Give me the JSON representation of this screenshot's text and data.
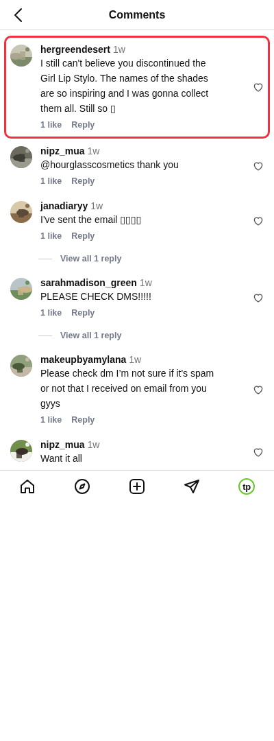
{
  "header": {
    "title": "Comments"
  },
  "comments": [
    {
      "username": "hergreendesert",
      "time": "1w",
      "text": "I still can't believe you discontinued the Girl Lip Stylo. The names of the shades are so inspiring and I was gonna collect them all. Still so ▯",
      "likes": "1 like",
      "reply": "Reply",
      "highlighted": true,
      "liked": false
    },
    {
      "username": "nipz_mua",
      "time": "1w",
      "text": "@hourglasscosmetics thank you",
      "likes": "1 like",
      "reply": "Reply",
      "highlighted": false,
      "liked": false
    },
    {
      "username": "janadiaryy",
      "time": "1w",
      "text": "I've sent the email ▯▯▯▯",
      "likes": "1 like",
      "reply": "Reply",
      "highlighted": false,
      "liked": false,
      "view_replies": "View all 1 reply"
    },
    {
      "username": "sarahmadison_green",
      "time": "1w",
      "text": "PLEASE CHECK DMS!!!!!",
      "likes": "1 like",
      "reply": "Reply",
      "highlighted": false,
      "liked": false,
      "view_replies": "View all 1 reply"
    },
    {
      "username": "makeupbyamylana",
      "time": "1w",
      "text": "Please check dm I’m not sure if it's spam or not that I received on email from you gyys",
      "likes": "1 like",
      "reply": "Reply",
      "highlighted": false,
      "liked": false
    },
    {
      "username": "nipz_mua",
      "time": "1w",
      "text": "Want it all",
      "highlighted": false,
      "liked": false
    }
  ],
  "nav": [
    {
      "kind": "home"
    },
    {
      "kind": "explore"
    },
    {
      "kind": "create"
    },
    {
      "kind": "messages"
    },
    {
      "kind": "profile",
      "label": "tp"
    }
  ]
}
